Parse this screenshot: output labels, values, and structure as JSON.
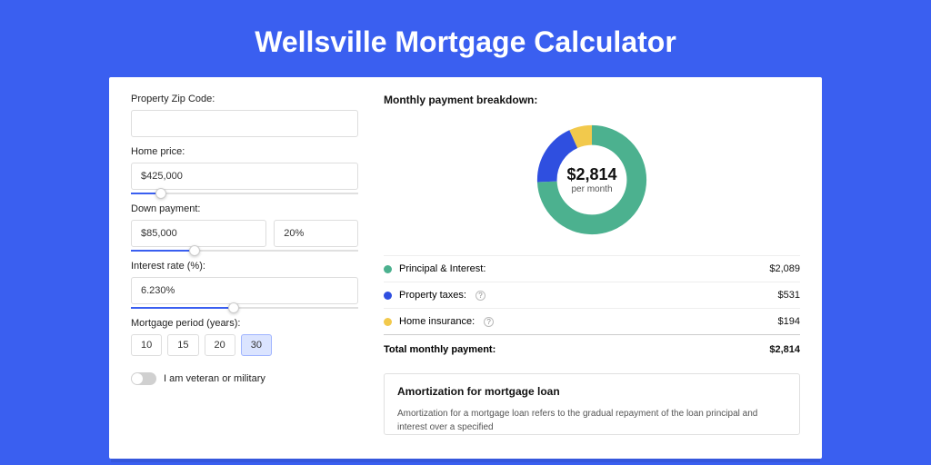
{
  "title": "Wellsville Mortgage Calculator",
  "form": {
    "zip_label": "Property Zip Code:",
    "zip_value": "",
    "home_price_label": "Home price:",
    "home_price_value": "$425,000",
    "home_price_slider_pct": 13,
    "down_label": "Down payment:",
    "down_value": "$85,000",
    "down_pct_value": "20%",
    "down_slider_pct": 28,
    "rate_label": "Interest rate (%):",
    "rate_value": "6.230%",
    "rate_slider_pct": 45,
    "period_label": "Mortgage period (years):",
    "periods": [
      "10",
      "15",
      "20",
      "30"
    ],
    "period_selected": "30",
    "veteran_label": "I am veteran or military"
  },
  "breakdown": {
    "heading": "Monthly payment breakdown:",
    "center_amount": "$2,814",
    "center_sub": "per month",
    "items": [
      {
        "label": "Principal & Interest:",
        "value": "$2,089",
        "color": "#4cb18f",
        "help": false
      },
      {
        "label": "Property taxes:",
        "value": "$531",
        "color": "#2f4fe0",
        "help": true
      },
      {
        "label": "Home insurance:",
        "value": "$194",
        "color": "#f2c94c",
        "help": true
      }
    ],
    "total_label": "Total monthly payment:",
    "total_value": "$2,814"
  },
  "chart_data": {
    "type": "pie",
    "title": "Monthly payment breakdown",
    "series": [
      {
        "name": "Principal & Interest",
        "value": 2089,
        "color": "#4cb18f"
      },
      {
        "name": "Property taxes",
        "value": 531,
        "color": "#2f4fe0"
      },
      {
        "name": "Home insurance",
        "value": 194,
        "color": "#f2c94c"
      }
    ],
    "total": 2814
  },
  "amort": {
    "title": "Amortization for mortgage loan",
    "text": "Amortization for a mortgage loan refers to the gradual repayment of the loan principal and interest over a specified"
  }
}
